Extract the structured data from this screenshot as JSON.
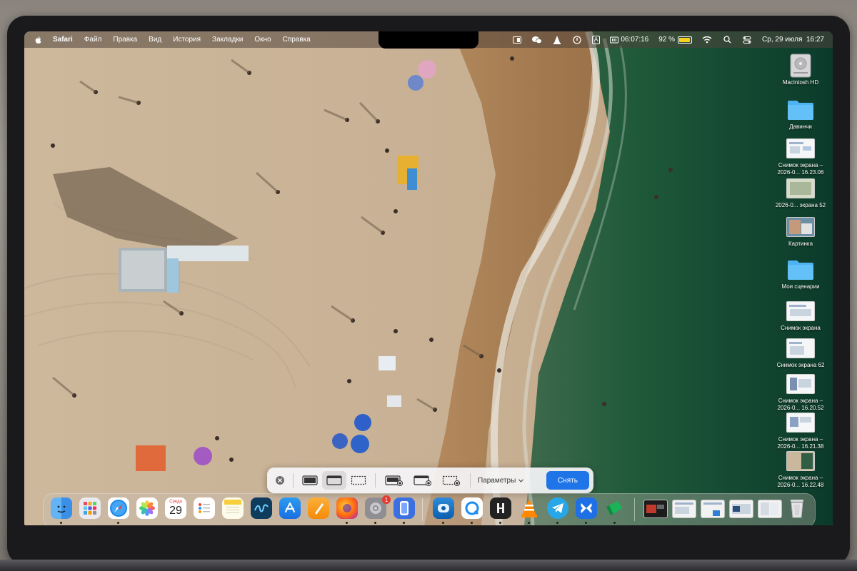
{
  "menubar": {
    "app_name": "Safari",
    "items": [
      "Файл",
      "Правка",
      "Вид",
      "История",
      "Закладки",
      "Окно",
      "Справка"
    ],
    "status_time_counter": "06:07:16",
    "battery_percent": "92 %",
    "battery_level": 0.92,
    "datetime": "Ср, 29 июля  16:27",
    "input_source": "A"
  },
  "desktop": {
    "items": [
      {
        "label": "Macintosh HD",
        "icon": "hard-drive-icon"
      },
      {
        "label": "Давинчи",
        "icon": "folder-icon"
      },
      {
        "label": "Снимок экрана –\n2026-0... 16.23.06",
        "icon": "screenshot-icon"
      },
      {
        "label": "2026-0... экрана 52",
        "icon": "screenshot-icon"
      },
      {
        "label": "Картинка",
        "icon": "image-icon"
      },
      {
        "label": "Мои сценарии",
        "icon": "folder-icon"
      },
      {
        "label": "Снимок экрана",
        "icon": "screenshot-icon"
      },
      {
        "label": "Снимок экрана 62",
        "icon": "screenshot-icon"
      },
      {
        "label": "Снимок экрана –\n2026-0... 16.20.52",
        "icon": "screenshot-icon"
      },
      {
        "label": "Снимок экрана –\n2026-0... 16.21.38",
        "icon": "screenshot-icon"
      },
      {
        "label": "Снимок экрана –\n2026-0... 16.22.48",
        "icon": "screenshot-icon"
      }
    ]
  },
  "capture_toolbar": {
    "options_label": "Параметры",
    "capture_label": "Снять"
  },
  "dock": {
    "calendar_day_label": "Среда",
    "calendar_day_number": "29",
    "settings_badge": "1"
  }
}
